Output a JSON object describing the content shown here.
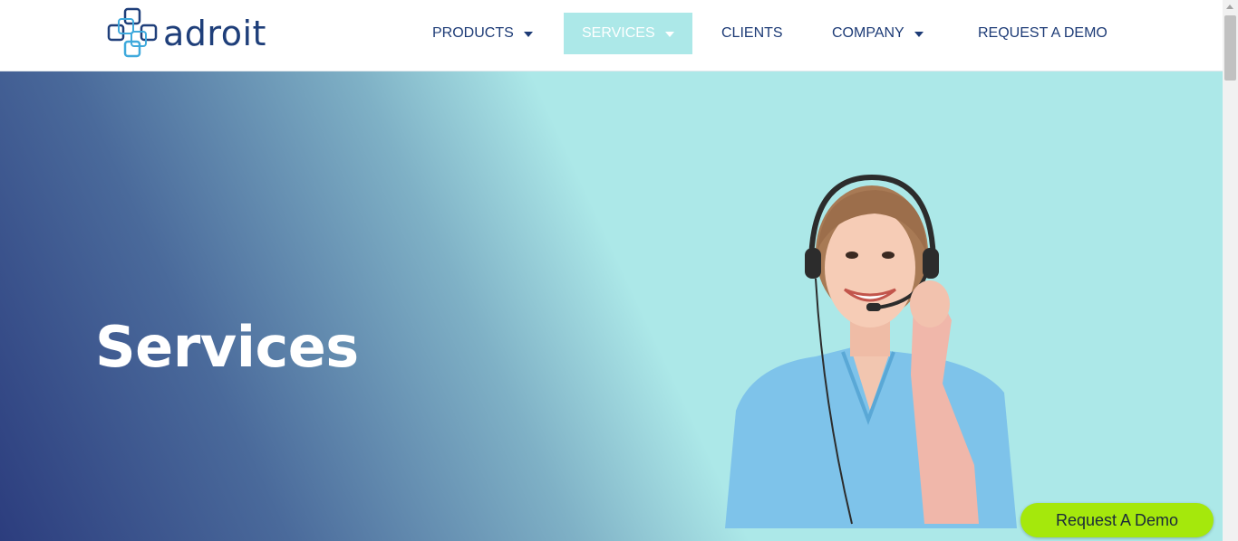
{
  "brand": {
    "name": "adroit",
    "logo_icon": "linked-squares-logo"
  },
  "nav": {
    "items": [
      {
        "label": "PRODUCTS",
        "has_dropdown": true,
        "active": false
      },
      {
        "label": "SERVICES",
        "has_dropdown": true,
        "active": true
      },
      {
        "label": "CLIENTS",
        "has_dropdown": false,
        "active": false
      },
      {
        "label": "COMPANY",
        "has_dropdown": true,
        "active": false
      },
      {
        "label": "REQUEST A DEMO",
        "has_dropdown": false,
        "active": false
      }
    ]
  },
  "hero": {
    "title": "Services",
    "image": "customer-support-agent-with-headset"
  },
  "floating_button": {
    "label": "Request A Demo"
  },
  "colors": {
    "primary_text": "#1d3b76",
    "active_nav_bg": "#ace8e8",
    "hero_gradient_start": "#2c3d7e",
    "hero_gradient_end": "#ace8e8",
    "cta_green": "#a5e80c"
  }
}
